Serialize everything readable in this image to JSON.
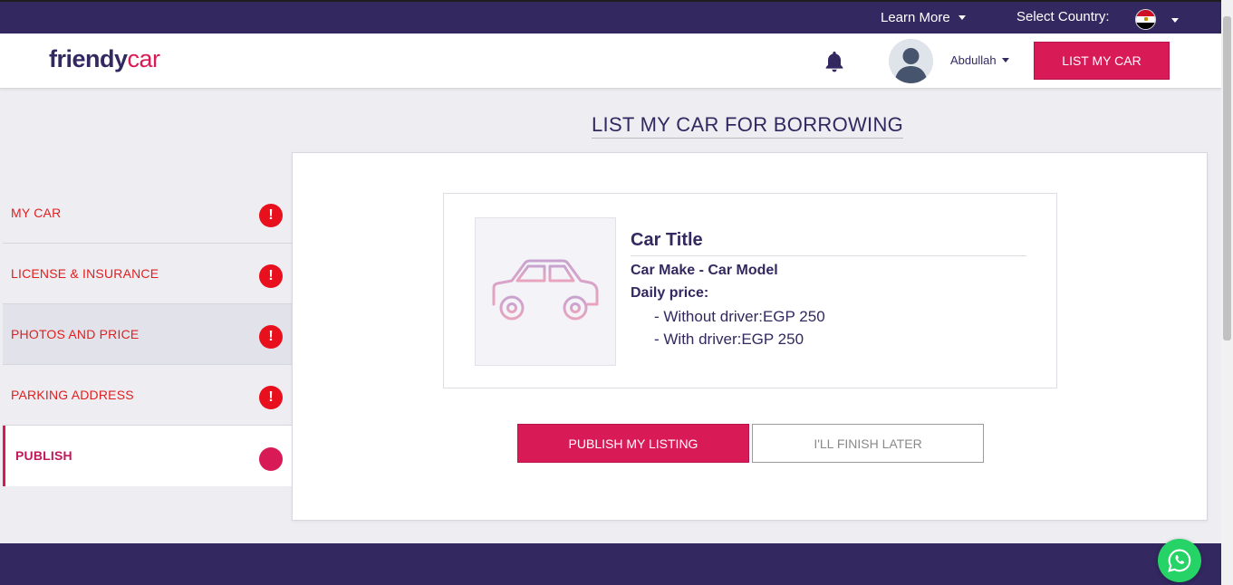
{
  "topbar": {
    "learn_more": "Learn More",
    "select_country": "Select Country:",
    "country_flag": "egypt-flag-icon"
  },
  "header": {
    "logo_friendy": "friendy",
    "logo_car": "car",
    "user_name": "Abdullah",
    "list_my_car": "LIST MY CAR",
    "notification_icon": "bell-icon"
  },
  "page": {
    "title": "LIST MY CAR FOR BORROWING"
  },
  "sidebar": {
    "steps": [
      {
        "label": "MY CAR",
        "status": "warning"
      },
      {
        "label": "LICENSE & INSURANCE",
        "status": "warning"
      },
      {
        "label": "PHOTOS AND PRICE",
        "status": "warning"
      },
      {
        "label": "PARKING ADDRESS",
        "status": "warning"
      },
      {
        "label": "PUBLISH",
        "status": "current"
      }
    ],
    "warning_glyph": "!"
  },
  "listing": {
    "title": "Car Title",
    "make_model": "Car Make - Car Model",
    "daily_price_label": "Daily price:",
    "price_without_driver": "- Without driver:EGP 250",
    "price_with_driver": "- With driver:EGP 250",
    "image_icon": "car-icon"
  },
  "actions": {
    "publish": "PUBLISH MY LISTING",
    "finish_later": "I'LL FINISH LATER"
  },
  "colors": {
    "primary": "#33285f",
    "accent": "#d81b56",
    "warning": "#e8101d",
    "whatsapp": "#25d366"
  }
}
